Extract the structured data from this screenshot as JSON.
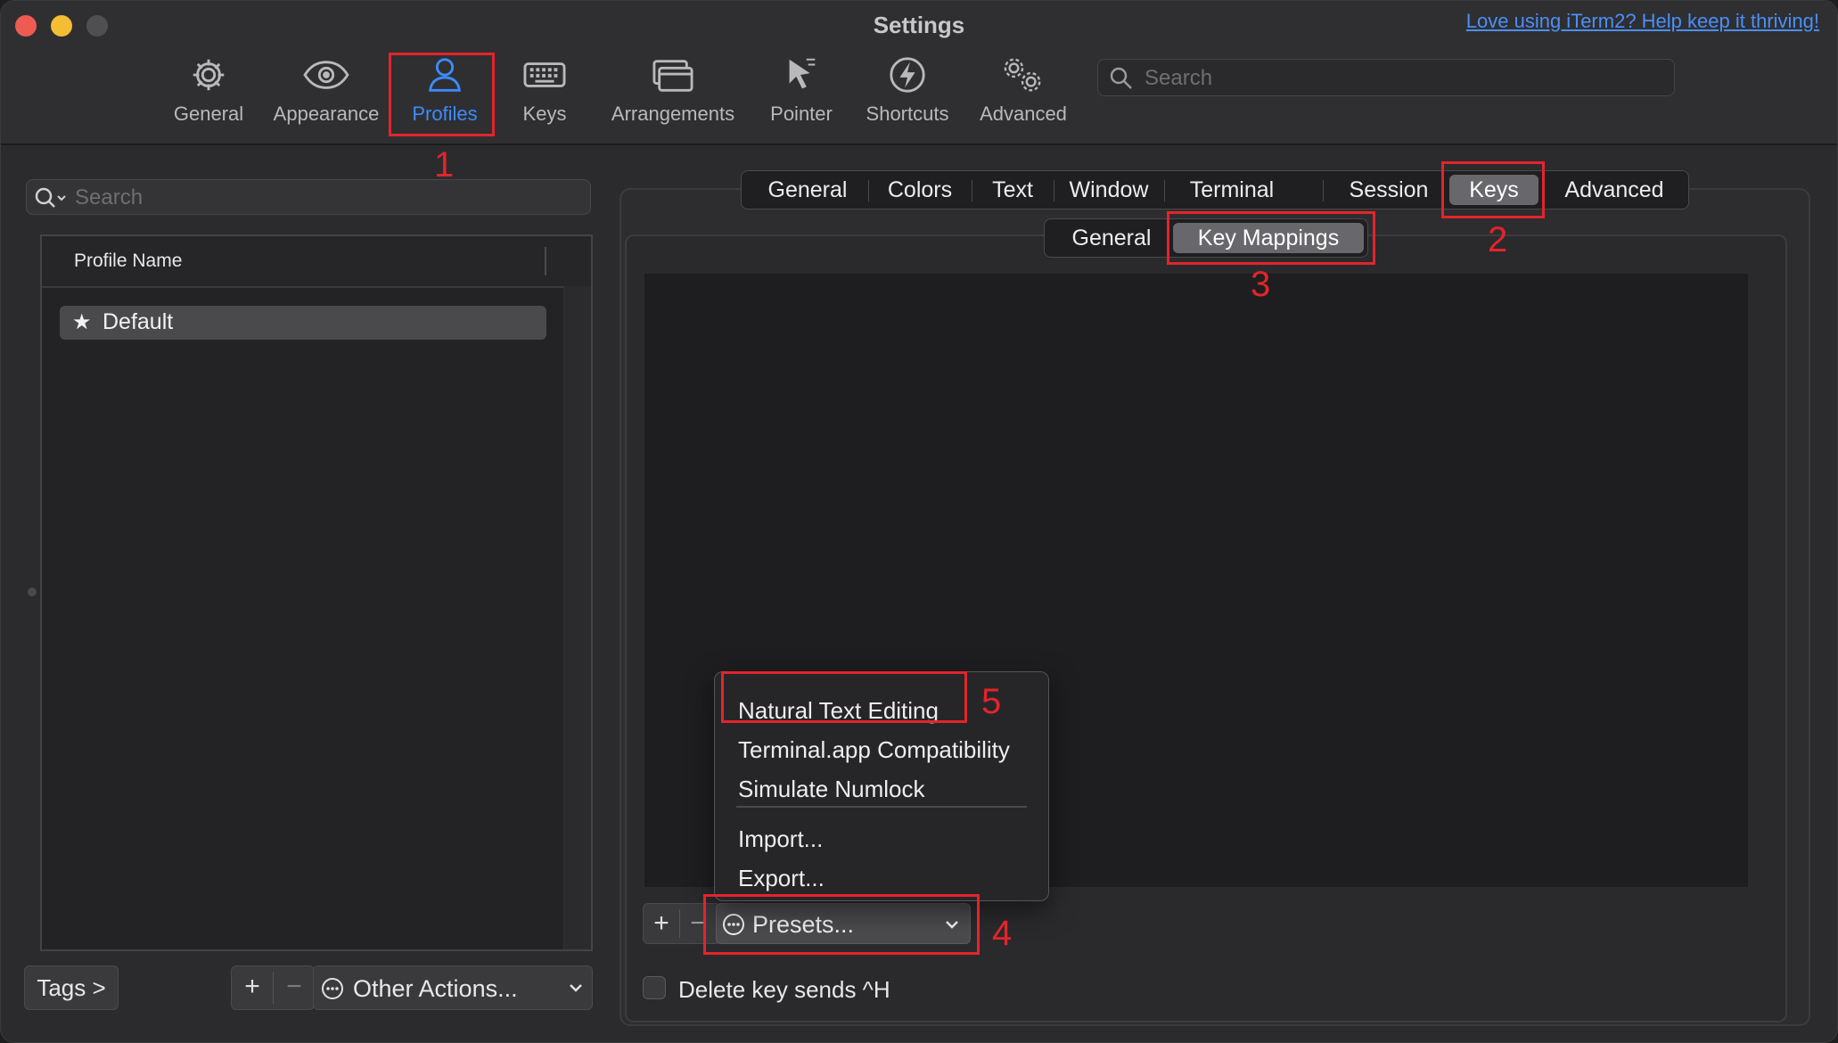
{
  "window": {
    "title": "Settings",
    "help_link": "Love using iTerm2? Help keep it thriving!"
  },
  "toolbar": {
    "items": [
      {
        "label": "General",
        "icon": "gear-icon"
      },
      {
        "label": "Appearance",
        "icon": "eye-icon"
      },
      {
        "label": "Profiles",
        "icon": "person-icon"
      },
      {
        "label": "Keys",
        "icon": "keyboard-icon"
      },
      {
        "label": "Arrangements",
        "icon": "windows-icon"
      },
      {
        "label": "Pointer",
        "icon": "cursor-icon"
      },
      {
        "label": "Shortcuts",
        "icon": "lightning-icon"
      },
      {
        "label": "Advanced",
        "icon": "gears-icon"
      }
    ],
    "active": "Profiles",
    "search_placeholder": "Search"
  },
  "left": {
    "search_placeholder": "Search",
    "column_header": "Profile Name",
    "profiles": [
      {
        "name": "Default",
        "default": true
      }
    ],
    "tags_label": "Tags >",
    "add_label": "+",
    "remove_label": "−",
    "other_actions_label": "Other Actions..."
  },
  "profile_tabs": {
    "items": [
      "General",
      "Colors",
      "Text",
      "Window",
      "Terminal",
      "Session",
      "Keys",
      "Advanced"
    ],
    "active": "Keys"
  },
  "keys_subtabs": {
    "items": [
      "General",
      "Key Mappings"
    ],
    "active": "Key Mappings"
  },
  "key_mappings": {
    "add_label": "+",
    "remove_label": "−",
    "presets_label": "Presets...",
    "delete_key_label": "Delete key sends ^H",
    "delete_key_checked": false
  },
  "presets_menu": {
    "items": [
      "Natural Text Editing",
      "Terminal.app Compatibility",
      "Simulate Numlock"
    ],
    "import_label": "Import...",
    "export_label": "Export..."
  },
  "annotations": [
    "1",
    "2",
    "3",
    "4",
    "5"
  ],
  "colors": {
    "accent": "#3d8bfd",
    "annotation": "#e3242b",
    "link": "#4a8ff7"
  }
}
